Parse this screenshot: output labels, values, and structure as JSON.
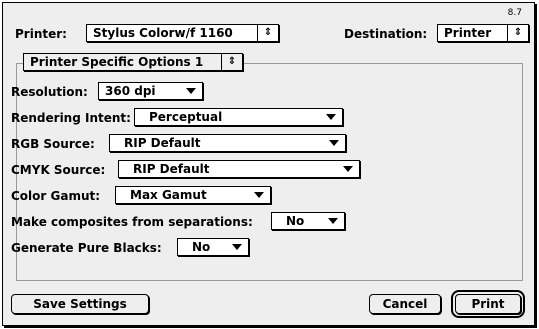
{
  "version": "8.7",
  "printer": {
    "label": "Printer:",
    "value": "Stylus Colorw/f 1160"
  },
  "destination": {
    "label": "Destination:",
    "value": "Printer"
  },
  "panel_selector": "Printer Specific Options 1",
  "options": {
    "resolution": {
      "label": "Resolution:",
      "value": "360 dpi"
    },
    "rendering_intent": {
      "label": "Rendering Intent:",
      "value": "Perceptual"
    },
    "rgb_source": {
      "label": "RGB Source:",
      "value": "RIP Default"
    },
    "cmyk_source": {
      "label": "CMYK Source:",
      "value": "RIP Default"
    },
    "color_gamut": {
      "label": "Color Gamut:",
      "value": "Max Gamut"
    },
    "composites": {
      "label": "Make composites from separations:",
      "value": "No"
    },
    "pure_blacks": {
      "label": "Generate Pure Blacks:",
      "value": "No"
    }
  },
  "buttons": {
    "save": "Save Settings",
    "cancel": "Cancel",
    "print": "Print"
  },
  "icons": {
    "popup": "triangle-down-icon",
    "stepper": "updown-arrows-icon"
  }
}
